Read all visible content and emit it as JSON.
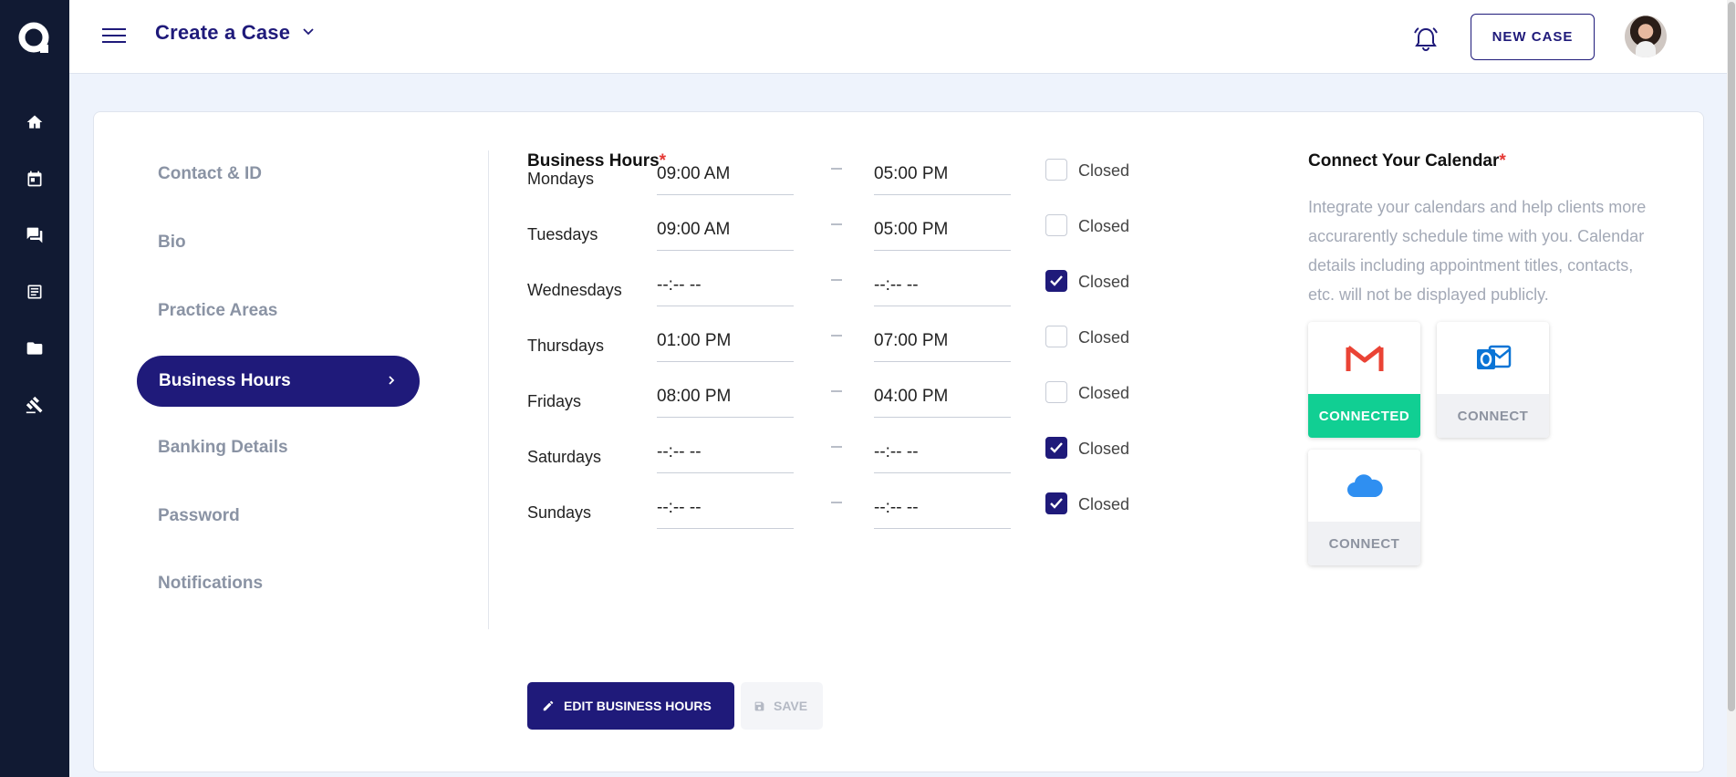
{
  "header": {
    "page_title": "Create a Case",
    "new_case_label": "NEW CASE"
  },
  "rail": {
    "items": [
      "home-icon",
      "calendar-icon",
      "chat-icon",
      "document-icon",
      "folder-icon",
      "gavel-icon"
    ]
  },
  "settings_nav": {
    "items": [
      {
        "label": "Contact & ID"
      },
      {
        "label": "Bio"
      },
      {
        "label": "Practice Areas"
      },
      {
        "label": "Business Hours",
        "active": true
      },
      {
        "label": "Banking Details"
      },
      {
        "label": "Password"
      },
      {
        "label": "Notifications"
      }
    ]
  },
  "business_hours": {
    "title": "Business Hours",
    "required_mark": "*",
    "closed_label": "Closed",
    "days": [
      {
        "day": "Mondays",
        "open": "09:00 AM",
        "close": "05:00 PM",
        "closed": false
      },
      {
        "day": "Tuesdays",
        "open": "09:00 AM",
        "close": "05:00 PM",
        "closed": false
      },
      {
        "day": "Wednesdays",
        "open": "--:-- --",
        "close": "--:-- --",
        "closed": true
      },
      {
        "day": "Thursdays",
        "open": "01:00 PM",
        "close": "07:00 PM",
        "closed": false
      },
      {
        "day": "Fridays",
        "open": "08:00 PM",
        "close": "04:00 PM",
        "closed": false
      },
      {
        "day": "Saturdays",
        "open": "--:-- --",
        "close": "--:-- --",
        "closed": true
      },
      {
        "day": "Sundays",
        "open": "--:-- --",
        "close": "--:-- --",
        "closed": true
      }
    ],
    "edit_button": "EDIT BUSINESS HOURS",
    "save_button": "SAVE"
  },
  "calendar": {
    "title": "Connect Your Calendar",
    "required_mark": "*",
    "description": "Integrate your calendars and help clients more accurarently schedule time with you. Calendar details including appointment titles, contacts, etc. will not be displayed publicly.",
    "providers": [
      {
        "icon": "gmail-icon",
        "status": "CONNECTED",
        "connected": true
      },
      {
        "icon": "outlook-icon",
        "status": "CONNECT",
        "connected": false
      },
      {
        "icon": "icloud-icon",
        "status": "CONNECT",
        "connected": false
      }
    ]
  },
  "colors": {
    "brand": "#1f1a7a",
    "rail_bg": "#111a33",
    "connected": "#11cf93",
    "required": "#e53935"
  }
}
